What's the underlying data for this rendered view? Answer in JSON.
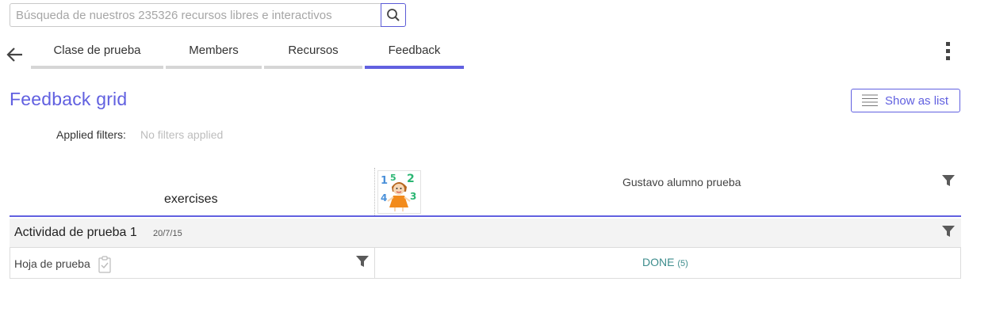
{
  "search": {
    "placeholder": "Búsqueda de nuestros 235326 recursos libres e interactivos"
  },
  "nav": {
    "tabs": [
      {
        "label": "Clase de prueba",
        "active": false
      },
      {
        "label": "Members",
        "active": false
      },
      {
        "label": "Recursos",
        "active": false
      },
      {
        "label": "Feedback",
        "active": true
      }
    ]
  },
  "main": {
    "title": "Feedback grid",
    "show_list_label": "Show as list",
    "filters_label": "Applied filters:",
    "filters_value": "No filters applied"
  },
  "grid": {
    "exercises_header": "exercises",
    "student_name": "Gustavo alumno prueba",
    "activity": {
      "name": "Actividad de prueba 1",
      "date": "20/7/15"
    },
    "sheet": {
      "name": "Hoja de prueba",
      "status": "DONE",
      "count": "(5)"
    }
  },
  "colors": {
    "accent": "#6160e0",
    "done": "#3d8d8d",
    "tab_inactive": "#d6d6d6"
  },
  "icons": [
    "search-icon",
    "back-arrow-icon",
    "more-vertical-icon",
    "list-icon",
    "filter-icon",
    "clipboard-check-icon"
  ]
}
